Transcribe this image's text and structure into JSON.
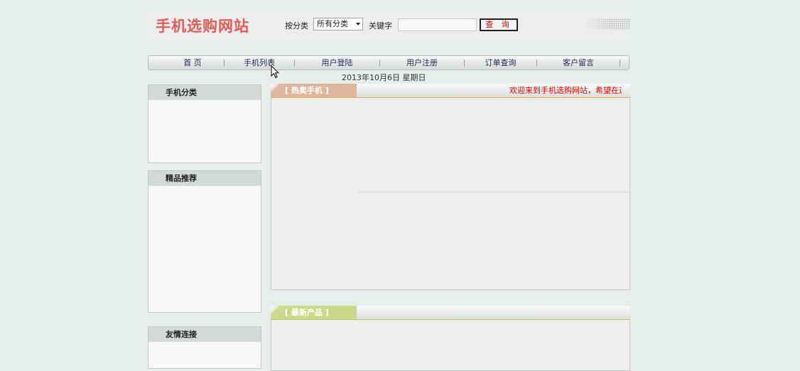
{
  "header": {
    "site_title": "手机选购网站",
    "category_label": "按分类",
    "category_selected": "所有分类",
    "keyword_label": "关键字",
    "keyword_value": "",
    "search_button": "查 询"
  },
  "nav": {
    "items": [
      {
        "label": "首  页"
      },
      {
        "label": "手机列表"
      },
      {
        "label": "用户登陆"
      },
      {
        "label": "用户注册"
      },
      {
        "label": "订单查询"
      },
      {
        "label": "客户留言"
      }
    ]
  },
  "date_text": "2013年10月6日  星期日",
  "sidebar": {
    "category_title": "手机分类",
    "featured_title": "精品推荐",
    "links_title": "友情连接"
  },
  "main": {
    "hot_title": "[ 热卖手机 ]",
    "marquee_text": "欢迎来到手机选购网站，希望在这",
    "new_title": "[ 最新产品 ]"
  },
  "colors": {
    "background": "#e6eeec",
    "site_title": "#e05a5a",
    "hot_tab": "#ddb79d",
    "new_tab": "#cbd98b",
    "marquee_text": "#d40000",
    "nav_text": "#1a2a55"
  }
}
